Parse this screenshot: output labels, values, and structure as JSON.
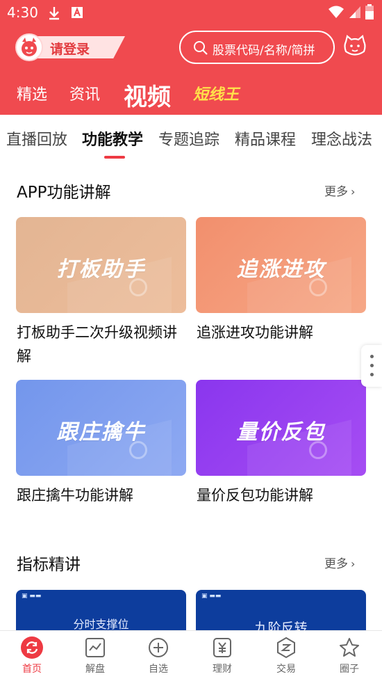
{
  "status_bar": {
    "time": "4:30"
  },
  "header": {
    "login_label": "请登录",
    "search_placeholder": "股票代码/名称/简拼",
    "tabs": [
      {
        "label": "精选",
        "active": false
      },
      {
        "label": "资讯",
        "active": false
      },
      {
        "label": "视频",
        "active": true
      },
      {
        "label": "短线王",
        "active": false
      }
    ]
  },
  "subtabs": [
    {
      "label": "直播回放",
      "active": false
    },
    {
      "label": "功能教学",
      "active": true
    },
    {
      "label": "专题追踪",
      "active": false
    },
    {
      "label": "精品课程",
      "active": false
    },
    {
      "label": "理念战法",
      "active": false
    }
  ],
  "sections": {
    "app_features": {
      "title": "APP功能讲解",
      "more": "更多",
      "cards": [
        {
          "banner_text": "打板助手",
          "caption": "打板助手二次升级视频讲解"
        },
        {
          "banner_text": "追涨进攻",
          "caption": "追涨进攻功能讲解"
        },
        {
          "banner_text": "跟庄擒牛",
          "caption": "跟庄擒牛功能讲解"
        },
        {
          "banner_text": "量价反包",
          "caption": "量价反包功能讲解"
        }
      ]
    },
    "indicators": {
      "title": "指标精讲",
      "more": "更多",
      "cards": [
        {
          "banner_text": "分时支撑位"
        },
        {
          "banner_text": "九阶反转"
        }
      ]
    }
  },
  "colors": {
    "header_red": "#f04a4f",
    "accent_red": "#ee3a43",
    "short_king_yellow": "#ffe14a",
    "card1": "#e7b08f",
    "card2": "#f59674",
    "card3": "#7c98ec",
    "card4": "#9b3ff0",
    "indicator_card": "#0d3d9d"
  },
  "bottom_nav": [
    {
      "label": "首页",
      "icon": "refresh-icon",
      "active": true
    },
    {
      "label": "解盘",
      "icon": "chart-icon",
      "active": false
    },
    {
      "label": "自选",
      "icon": "plus-circle-icon",
      "active": false
    },
    {
      "label": "理财",
      "icon": "yuan-icon",
      "active": false
    },
    {
      "label": "交易",
      "icon": "trade-icon",
      "active": false
    },
    {
      "label": "圈子",
      "icon": "star-icon",
      "active": false
    }
  ]
}
